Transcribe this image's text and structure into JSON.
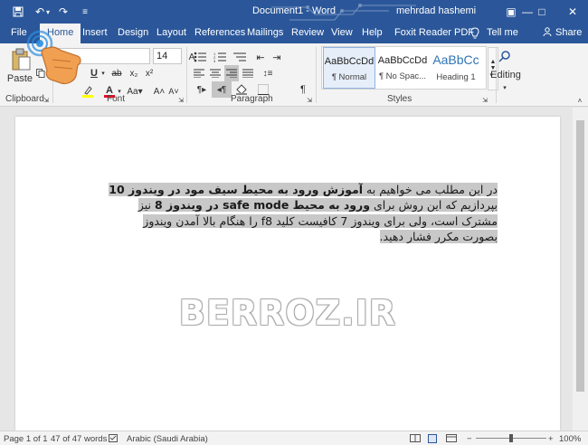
{
  "titlebar": {
    "title": "Document1 - Word",
    "user": "mehrdad hashemi",
    "save_icon": "🖫",
    "undo_icon": "↶",
    "redo_icon": "↷",
    "customize_icon": "≡",
    "ribbon_options_icon": "▣",
    "minimize_icon": "—",
    "maximize_icon": "□",
    "close_icon": "✕"
  },
  "tabs": {
    "file": "File",
    "home": "Home",
    "insert": "Insert",
    "design": "Design",
    "layout": "Layout",
    "references": "References",
    "mailings": "Mailings",
    "review": "Review",
    "view": "View",
    "help": "Help",
    "foxit": "Foxit Reader PDF",
    "tellme": "Tell me",
    "share": "Share"
  },
  "ribbon": {
    "paste_label": "Paste",
    "clipboard_label": "Clipboard",
    "font_label": "Font",
    "paragraph_label": "Paragraph",
    "styles_label": "Styles",
    "font_name": "na",
    "font_size": "14",
    "editing_label": "Editing",
    "styles": [
      {
        "preview": "AaBbCcDd",
        "name": "¶ Normal"
      },
      {
        "preview": "AaBbCcDd",
        "name": "¶ No Spac..."
      },
      {
        "preview": "AaBbCс",
        "name": "Heading 1"
      }
    ]
  },
  "document": {
    "line1_a": "در این مطلب می خواهیم به ",
    "line1_b": "آموزش ورود به محیط سیف مود در ویندوز 10",
    "line2_a": " بپردازیم که این روش برای ",
    "line2_b": "ورود به محیط safe mode در ویندوز 8",
    "line2_c": " نیز مشترک است، ولی برای ویندوز 7 کافیست کلید f8 را هنگام بالا آمدن ویندوز بصورت مکرر فشار دهید.",
    "watermark": "BERROZ.IR"
  },
  "status": {
    "page": "Page 1 of 1",
    "words": "47 of 47 words",
    "language": "Arabic (Saudi Arabia)",
    "zoom": "100%",
    "zoom_minus": "−",
    "zoom_plus": "+"
  },
  "colors": {
    "titlebar": "#2b579a",
    "ribbon": "#f3f3f3",
    "selection": "#c8c8c8",
    "font_color_underline": "#e81123",
    "highlight_underline": "#ffff00"
  }
}
